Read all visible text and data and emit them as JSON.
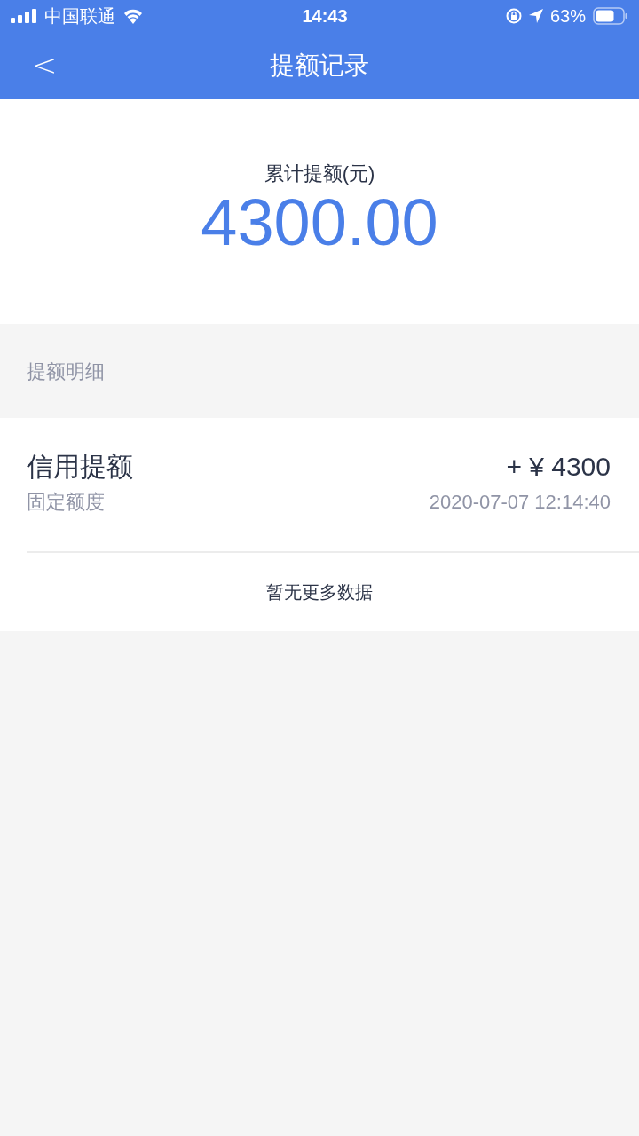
{
  "status_bar": {
    "carrier": "中国联通",
    "time": "14:43",
    "battery": "63%"
  },
  "nav": {
    "back": "<",
    "title": "提额记录"
  },
  "summary": {
    "label": "累计提额(元)",
    "amount": "4300.00"
  },
  "section_title": "提额明细",
  "records": [
    {
      "title": "信用提额",
      "subtitle": "固定额度",
      "amount": "+ ¥ 4300",
      "date": "2020-07-07 12:14:40"
    }
  ],
  "footer": "暂无更多数据"
}
